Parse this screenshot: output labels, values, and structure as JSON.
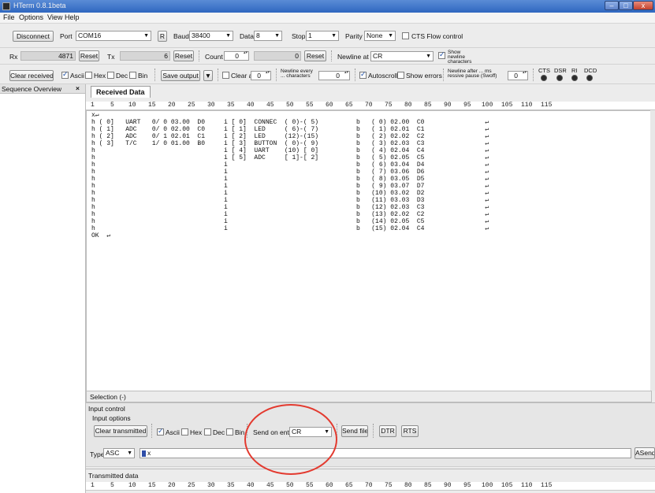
{
  "window": {
    "title": "HTerm 0.8.1beta",
    "controls": {
      "minimize": "–",
      "maximize": "□",
      "close": "x"
    }
  },
  "menu": [
    "File",
    "Options",
    "View",
    "Help"
  ],
  "connection": {
    "disconnect_label": "Disconnect",
    "port_label": "Port",
    "port_value": "COM16",
    "refresh_label": "R",
    "baud_label": "Baud",
    "baud_value": "38400",
    "data_label": "Data",
    "data_value": "8",
    "stop_label": "Stop",
    "stop_value": "1",
    "parity_label": "Parity",
    "parity_value": "None",
    "cts_label": "CTS Flow control"
  },
  "counters": {
    "rx_label": "Rx",
    "rx_value": "4871",
    "rx_reset": "Reset",
    "tx_label": "Tx",
    "tx_value": "6",
    "tx_reset": "Reset",
    "count_label": "Count",
    "count_value": "0",
    "count_field_value": "0",
    "count_reset": "Reset",
    "newline_label": "Newline at",
    "newline_value": "CR",
    "show_newline_label": "Show newline characters"
  },
  "receive_options": {
    "clear_received": "Clear received",
    "ascii": "Ascii",
    "hex": "Hex",
    "dec": "Dec",
    "bin": "Bin",
    "save_output": "Save output",
    "clear_at_label": "Clear at",
    "clear_at_value": "0",
    "newline_every_label": "Newline every ... characters",
    "newline_every_value": "0",
    "autoscroll": "Autoscroll",
    "show_errors": "Show errors",
    "newline_after_label": "Newline after ... ms ressive pause (Swoff)",
    "newline_after_value": "0",
    "lines": [
      "CTS",
      "DSR",
      "RI",
      "DCD"
    ]
  },
  "left_panel": {
    "title": "Sequence Overview",
    "close": "×"
  },
  "received": {
    "tab_label": "Received Data",
    "ruler": [
      "1",
      "5",
      "10",
      "15",
      "20",
      "25",
      "30",
      "35",
      "40",
      "45",
      "50",
      "55",
      "60",
      "65",
      "70",
      "75",
      "80",
      "85",
      "90",
      "95",
      "100",
      "105",
      "110",
      "115"
    ],
    "lines": [
      "x↵",
      "h ( 0]   UART   0/ 0 03.00  D0     i [ 0]  CONNEC  ( 0)-( 5)          b   ( 0) 02.00  C0                ↵",
      "h ( 1]   ADC    0/ 0 02.00  C0     i [ 1]  LED     ( 6)-( 7)          b   ( 1) 02.01  C1                ↵",
      "h ( 2]   ADC    0/ 1 02.01  C1     i [ 2]  LED     (12)-(15)          b   ( 2) 02.02  C2                ↵",
      "h ( 3]   T/C    1/ 0 01.00  B0     i [ 3]  BUTTON  ( 0)-( 9)          b   ( 3) 02.03  C3                ↵",
      "h                                  i [ 4]  UART    (10) [ 0]          b   ( 4) 02.04  C4                ↵",
      "h                                  i [ 5]  ADC     [ 1]-[ 2]          b   ( 5) 02.05  C5                ↵",
      "h                                  i                                  b   ( 6) 03.04  D4                ↵",
      "h                                  i                                  b   ( 7) 03.06  D6                ↵",
      "h                                  i                                  b   ( 8) 03.05  D5                ↵",
      "h                                  i                                  b   ( 9) 03.07  D7                ↵",
      "h                                  i                                  b   (10) 03.02  D2                ↵",
      "h                                  i                                  b   (11) 03.03  D3                ↵",
      "h                                  i                                  b   (12) 02.03  C3                ↵",
      "h                                  i                                  b   (13) 02.02  C2                ↵",
      "h                                  i                                  b   (14) 02.05  C5                ↵",
      "h                                  i                                  b   (15) 02.04  C4                ↵",
      "OK  ↵"
    ],
    "selection": "Selection (-)"
  },
  "input_control": {
    "title": "Input control",
    "options_label": "Input options",
    "clear_transmitted": "Clear transmitted",
    "ascii": "Ascii",
    "hex": "Hex",
    "dec": "Dec",
    "bin": "Bin",
    "send_on_enter_label": "Send on enter",
    "send_on_enter_value": "CR",
    "send_file": "Send file",
    "dtr": "DTR",
    "rts": "RTS",
    "type_label": "Type",
    "type_value": "ASC",
    "input_value": "x",
    "asend": "ASend"
  },
  "transmitted": {
    "title": "Transmitted data",
    "ruler": [
      "1",
      "5",
      "10",
      "15",
      "20",
      "25",
      "30",
      "35",
      "40",
      "45",
      "50",
      "55",
      "60",
      "65",
      "70",
      "75",
      "80",
      "85",
      "90",
      "95",
      "100",
      "105",
      "110",
      "115"
    ]
  },
  "colors": {
    "highlight_circle": "#e33a2f",
    "titlebar": "#3a72c8",
    "background": "#f6a23a"
  }
}
